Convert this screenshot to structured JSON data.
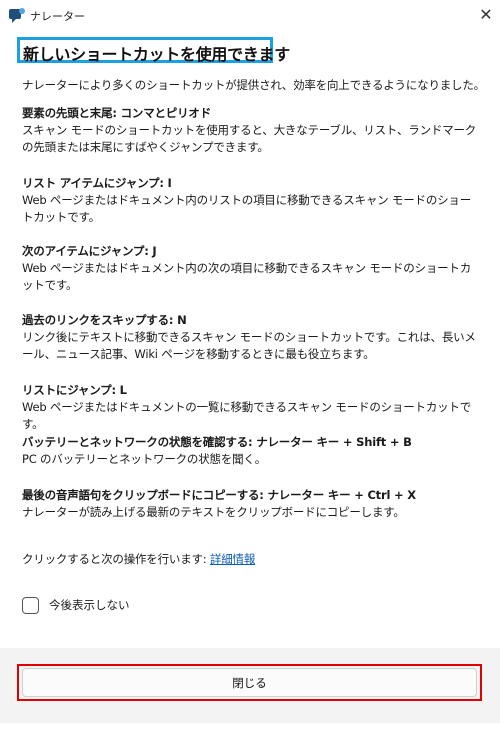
{
  "window": {
    "title": "ナレーター",
    "close_glyph": "✕"
  },
  "headline": "新しいショートカットを使用できます",
  "intro": "ナレーターにより多くのショートカットが提供され、効率を向上できるようになりました。",
  "items": [
    {
      "title": "要素の先頭と末尾: コンマとピリオド",
      "desc": "スキャン モードのショートカットを使用すると、大きなテーブル、リスト、ランドマークの先頭または末尾にすばやくジャンプできます。"
    },
    {
      "title": "リスト アイテムにジャンプ: I",
      "desc": "Web ページまたはドキュメント内のリストの項目に移動できるスキャン モードのショートカットです。"
    },
    {
      "title": "次のアイテムにジャンプ: J",
      "desc": "Web ページまたはドキュメント内の次の項目に移動できるスキャン モードのショートカットです。"
    },
    {
      "title": "過去のリンクをスキップする: N",
      "desc": "リンク後にテキストに移動できるスキャン モードのショートカットです。これは、長いメール、ニュース記事、Wiki ページを移動するときに最も役立ちます。"
    },
    {
      "title": "リストにジャンプ: L",
      "desc": "Web ページまたはドキュメントの一覧に移動できるスキャン モードのショートカットです。"
    },
    {
      "title": "バッテリーとネットワークの状態を確認する: ナレーター キー + Shift + B",
      "desc": "PC のバッテリーとネットワークの状態を聞く。"
    },
    {
      "title": "最後の音声語句をクリップボードにコピーする: ナレーター キー + Ctrl + X",
      "desc": "ナレーターが読み上げる最新のテキストをクリップボードにコピーします。"
    }
  ],
  "more_prefix": "クリックすると次の操作を行います: ",
  "more_link": "詳細情報",
  "checkbox_label": "今後表示しない",
  "checkbox_checked": false,
  "close_button": "閉じる",
  "colors": {
    "highlight": "#1ba1e2",
    "focus": "#e00000",
    "link": "#0b5cad"
  }
}
